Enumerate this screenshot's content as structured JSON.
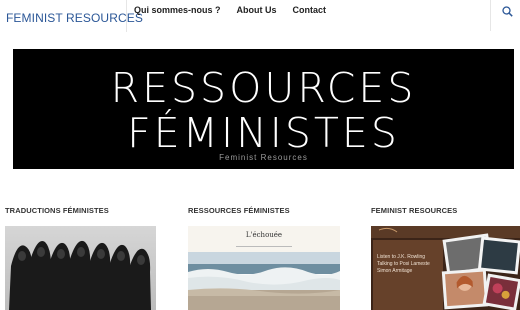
{
  "header": {
    "site_title": "FEMINIST RESOURCES",
    "nav": [
      {
        "label": "Qui sommes-nous ?"
      },
      {
        "label": "About Us"
      },
      {
        "label": "Contact"
      }
    ],
    "search_icon": "search-icon"
  },
  "hero": {
    "title_line1": "RESSOURCES",
    "title_line2": "FÉMINISTES",
    "subtitle": "Feminist Resources"
  },
  "sections": [
    {
      "heading": "TRADUCTIONS FÉMINISTES"
    },
    {
      "heading": "RESSOURCES FÉMINISTES",
      "thumb_title": "L'échouée"
    },
    {
      "heading": "FEMINIST RESOURCES",
      "thumb_text": "Listen to J.K. Rowling Talking to Posi Lameste Simon Armitage"
    }
  ],
  "colors": {
    "title_blue": "#2b5797",
    "hero_bg": "#000000"
  }
}
